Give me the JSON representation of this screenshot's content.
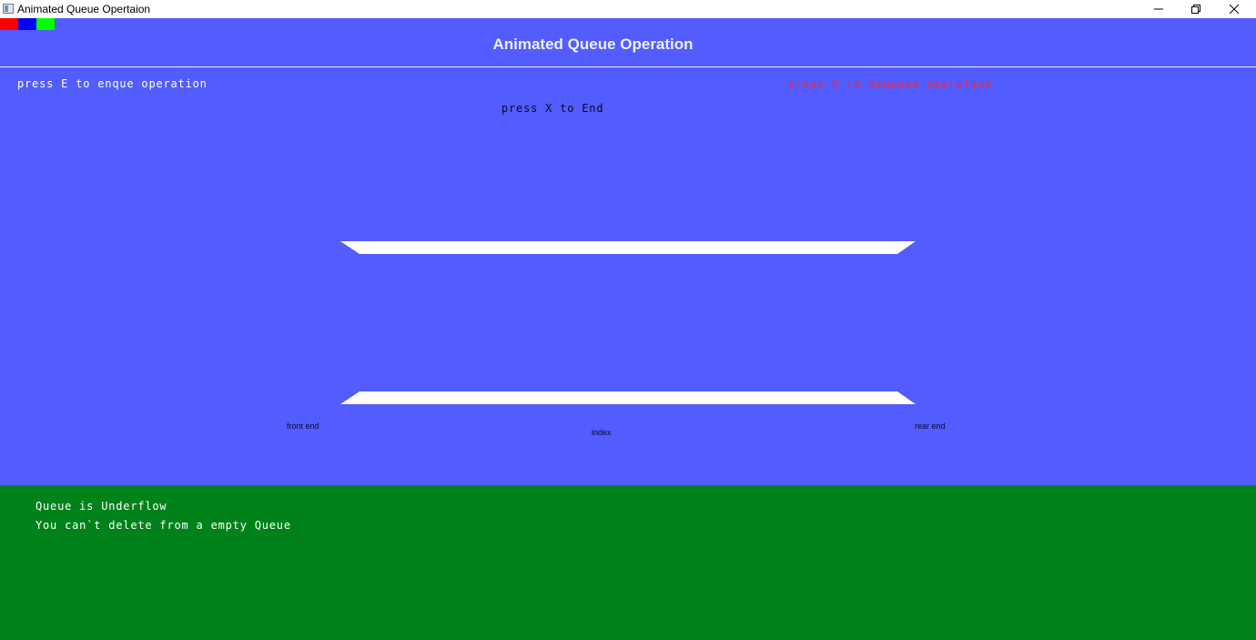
{
  "window": {
    "title": "Animated Queue Opertaion",
    "controls": {
      "minimize": "minimize-icon",
      "maximize": "restore-icon",
      "close": "close-icon"
    }
  },
  "palette": {
    "swatches": [
      "#ff0000",
      "#0000ff",
      "#00ff00"
    ],
    "scene_background": "#525cff",
    "message_background": "#00821a",
    "queue_rails": "#ffffff"
  },
  "scene": {
    "heading": "Animated Queue Operation",
    "enqueue_hint": "press E to enque operation",
    "dequeue_hint": "press D to dequeue operation",
    "end_hint": "press X to End",
    "labels": {
      "front": "front end",
      "index": "index",
      "rear": "rear end"
    },
    "queue_items": []
  },
  "messages": {
    "line1": "Queue is Underflow",
    "line2": "You can`t delete from a empty Queue"
  }
}
